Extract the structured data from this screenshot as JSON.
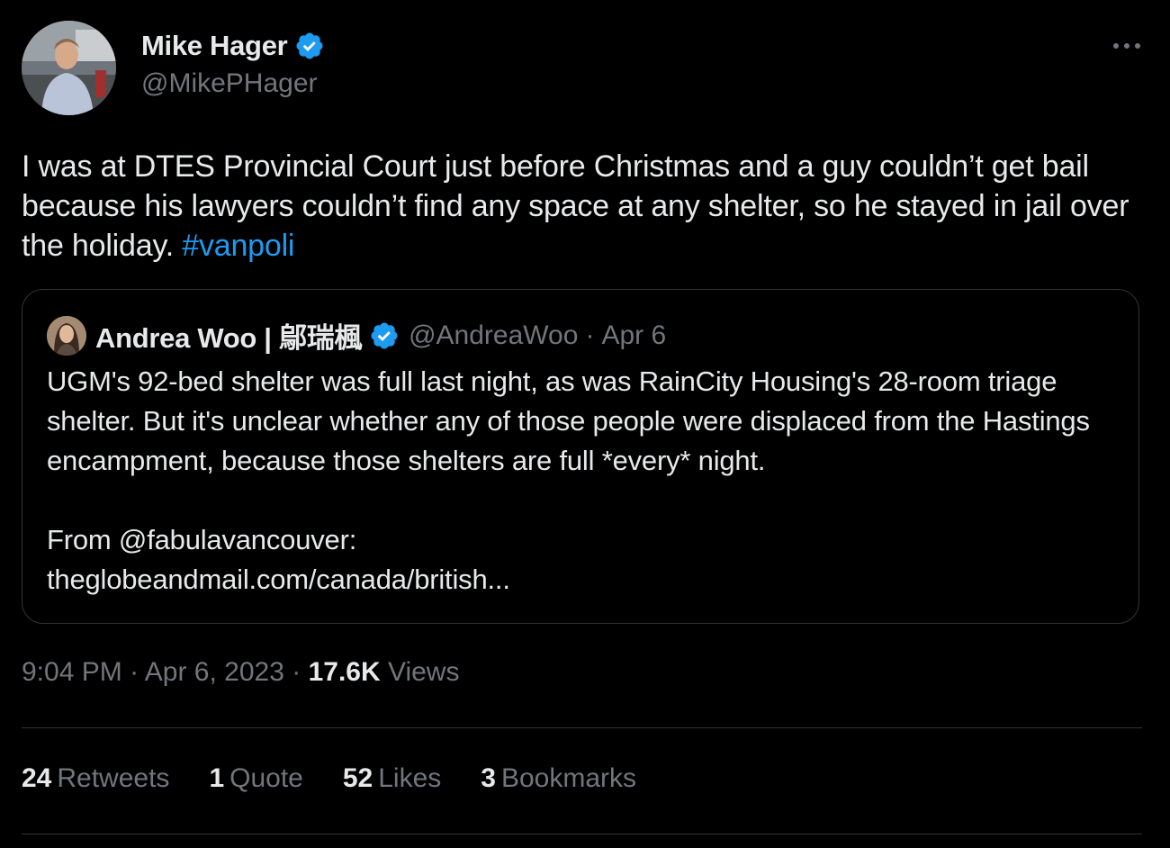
{
  "author": {
    "name": "Mike Hager",
    "handle": "@MikePHager"
  },
  "tweet": {
    "text": "I was at DTES Provincial Court just before Christmas and a guy couldn’t get bail because his lawyers couldn’t find any space at any shelter, so he stayed in jail over the holiday. ",
    "hashtag": "#vanpoli"
  },
  "quote": {
    "author_name": "Andrea Woo | 鄔瑞楓",
    "handle": "@AndreaWoo",
    "separator": "·",
    "date": "Apr 6",
    "paragraph1": "UGM's 92-bed shelter was full last night, as was RainCity Housing's 28-room triage shelter. But it's unclear whether any of those people were displaced from the Hastings encampment, because those shelters are full *every* night.",
    "line_from": "From @fabulavancouver:",
    "link": "theglobeandmail.com/canada/british..."
  },
  "meta": {
    "time": "9:04 PM",
    "separator": "·",
    "date": "Apr 6, 2023",
    "views_count": "17.6K",
    "views_label": "Views"
  },
  "stats": [
    {
      "count": "24",
      "label": "Retweets"
    },
    {
      "count": "1",
      "label": "Quote"
    },
    {
      "count": "52",
      "label": "Likes"
    },
    {
      "count": "3",
      "label": "Bookmarks"
    }
  ],
  "colors": {
    "background": "#000000",
    "text": "#e7e9ea",
    "secondary": "#71767b",
    "accent": "#1d9bf0",
    "border": "#2f3336"
  },
  "icons": {
    "verified": "verified-badge-icon",
    "more": "more-horizontal-icon"
  }
}
